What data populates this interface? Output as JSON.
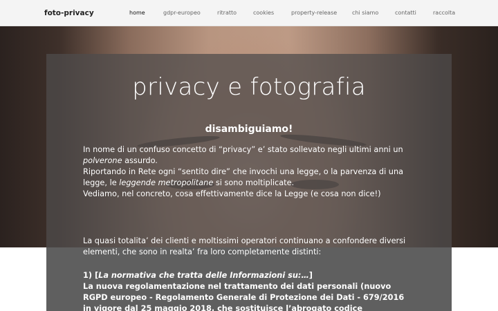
{
  "nav": {
    "brand": "foto-privacy",
    "links": [
      {
        "label": "home",
        "active": true
      },
      {
        "label": "gdpr-europeo"
      },
      {
        "label": "ritratto"
      },
      {
        "label": "cookies"
      },
      {
        "label": "property-release"
      },
      {
        "label": "chi siamo"
      },
      {
        "label": "contatti"
      },
      {
        "label": "raccolta"
      }
    ]
  },
  "hero": {
    "title": "privacy e fotografia",
    "subtitle": "disambiguiamo!"
  },
  "intro": {
    "p1_a": "In nome di un confuso concetto di “privacy”  e’ stato sollevato negli ultimi anni un ",
    "p1_em": "polverone",
    "p1_b": " assurdo.",
    "p2_a": "Riportando in Rete ogni “sentito dire” che invochi una legge, o la parvenza di una legge, le ",
    "p2_em": "leggende metropolitane",
    "p2_b": " si sono moltiplicate.",
    "p3": "Vediamo, nel concreto, cosa effettivamente dice la Legge (e cosa non dice!)"
  },
  "body": {
    "p4": "La quasi totalita’ dei clienti e moltissimi operatori continuano a confondere diversi elementi, che sono in realta’ fra loro completamente distinti:",
    "item1_prefix": "1) [",
    "item1_em": "La normativa che tratta delle Informazioni su:…",
    "item1_suffix": "]",
    "item1_text": "La nuova regolamentazione nel trattamento dei dati personali (nuovo RGPD europeo - Regolamento Generale di Protezione dei Dati - 679/2016 in vigore dal 25 maggio 2018, che sostituisce l’abrogato codice protezione dati personali - privacy"
  },
  "colors": {
    "nav_bg": "#f4f4f4",
    "panel_overlay": "#4e4c4b",
    "text": "#ffffff"
  }
}
